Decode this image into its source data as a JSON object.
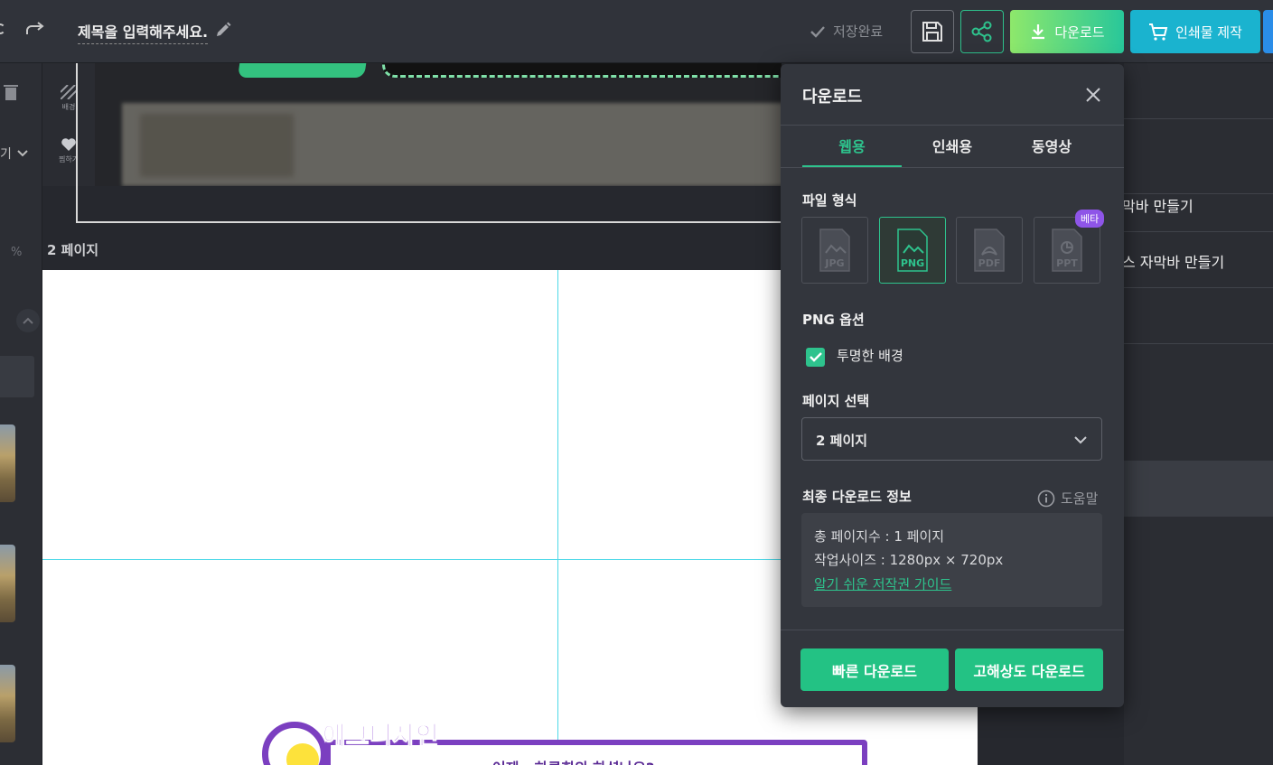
{
  "topbar": {
    "doc_title": "제목을 입력해주세요.",
    "save_status": "저장완료",
    "download_label": "다운로드",
    "print_label": "인쇄물 제작"
  },
  "rail": {
    "background_label": "배경",
    "like_label": "찜하기"
  },
  "left_panel": {
    "dropdown_text": "기",
    "percent": "%"
  },
  "canvas": {
    "page2_label": "2 페이지",
    "page2_title": "에그디자인",
    "page2_subtitle": "어제 · 하루회의 하셨나요?"
  },
  "right_sidebar": {
    "items": [
      "막바 만들기",
      "스 자막바 만들기"
    ]
  },
  "popover": {
    "title": "다운로드",
    "tabs": [
      {
        "label": "웹용",
        "active": true
      },
      {
        "label": "인쇄용",
        "active": false
      },
      {
        "label": "동영상",
        "active": false
      }
    ],
    "file_format_label": "파일 형식",
    "formats": [
      {
        "label": "JPG",
        "selected": false
      },
      {
        "label": "PNG",
        "selected": true
      },
      {
        "label": "PDF",
        "selected": false
      },
      {
        "label": "PPT",
        "selected": false
      }
    ],
    "beta_badge": "베타",
    "options_label": "PNG 옵션",
    "transparent_label": "투명한 배경",
    "transparent_checked": true,
    "page_select_label": "페이지 선택",
    "page_select_value": "2 페이지",
    "final_info_label": "최종 다운로드 정보",
    "help_label": "도움말",
    "info": {
      "total_pages": "총 페이지수 : 1 페이지",
      "work_size": "작업사이즈 : 1280px × 720px",
      "guide_link": "알기 쉬운 저작권 가이드"
    },
    "quick_download": "빠른 다운로드",
    "hires_download": "고해상도 다운로드"
  },
  "colors": {
    "accent_green": "#2ec38d",
    "print_cyan": "#1ab3cf",
    "beta_purple": "#8e55e8",
    "panel_bg": "#33363d"
  }
}
